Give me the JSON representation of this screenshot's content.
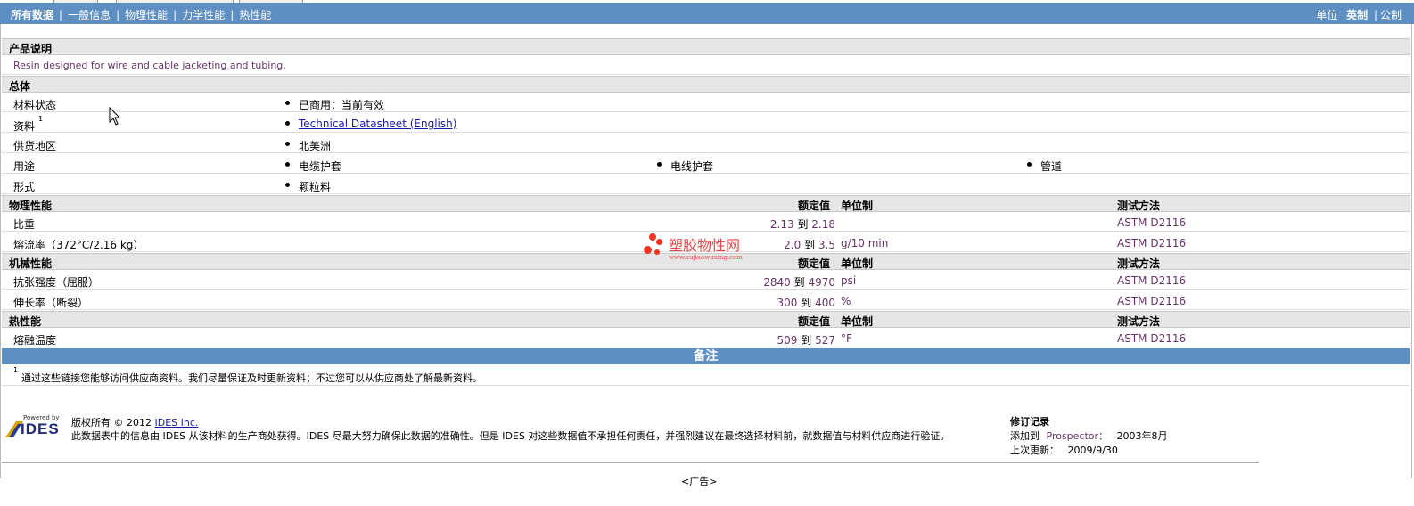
{
  "nav": {
    "tabs": [
      "所有数据",
      "一般信息",
      "物理性能",
      "力学性能",
      "热性能"
    ],
    "unit_label": "单位",
    "unit_english": "英制",
    "unit_metric": "公制"
  },
  "description": {
    "header": "产品说明",
    "text": "Resin designed for wire and cable jacketing and tubing."
  },
  "general": {
    "header": "总体",
    "rows": [
      {
        "label": "材料状态",
        "values": [
          "已商用：当前有效"
        ]
      },
      {
        "label": "资料",
        "sup": "1",
        "values": [
          "Technical Datasheet (English)"
        ]
      },
      {
        "label": "供货地区",
        "values": [
          "北美洲"
        ]
      },
      {
        "label": "用途",
        "values": [
          "电缆护套",
          "电线护套",
          "管道"
        ]
      },
      {
        "label": "形式",
        "values": [
          "颗粒料"
        ]
      }
    ]
  },
  "physical": {
    "header": "物理性能",
    "col_value": "额定值",
    "col_unit": "单位制",
    "col_test": "测试方法",
    "rows": [
      {
        "label": "比重",
        "low": "2.13",
        "to": "到",
        "high": "2.18",
        "unit": "",
        "test": "ASTM D2116"
      },
      {
        "label": "熔流率（372°C/2.16 kg）",
        "low": "2.0",
        "to": "到",
        "high": "3.5",
        "unit": "g/10 min",
        "test": "ASTM D2116"
      }
    ]
  },
  "mechanical": {
    "header": "机械性能",
    "col_value": "额定值",
    "col_unit": "单位制",
    "col_test": "测试方法",
    "rows": [
      {
        "label": "抗张强度（屈服）",
        "low": "2840",
        "to": "到",
        "high": "4970",
        "unit": "psi",
        "test": "ASTM D2116"
      },
      {
        "label": "伸长率（断裂）",
        "low": "300",
        "to": "到",
        "high": "400",
        "unit": "%",
        "test": "ASTM D2116"
      }
    ]
  },
  "thermal": {
    "header": "热性能",
    "col_value": "额定值",
    "col_unit": "单位制",
    "col_test": "测试方法",
    "rows": [
      {
        "label": "熔融温度",
        "low": "509",
        "to": "到",
        "high": "527",
        "unit": "°F",
        "test": "ASTM D2116"
      }
    ]
  },
  "notes": {
    "header": "备注",
    "sup": "1",
    "text": "通过这些链接您能够访问供应商资料。我们尽量保证及时更新资料；不过您可以从供应商处了解最新资料。"
  },
  "watermark": {
    "name": "塑胶物性网",
    "url": "www.sujiaowuxing.com"
  },
  "footer": {
    "logo_small": "Powered by",
    "logo": "IDES",
    "copyright": "版权所有 © 2012",
    "company_link": "IDES Inc.",
    "disclaimer": "此数据表中的信息由 IDES 从该材料的生产商处获得。IDES 尽最大努力确保此数据的准确性。但是 IDES 对这些数据值不承担任何责任，并强烈建议在最终选择材料前，就数据值与材料供应商进行验证。",
    "revision_title": "修订记录",
    "added_label": "添加到",
    "added_target": "Prospector：",
    "added_date": "2003年8月",
    "updated_label": "上次更新：",
    "updated_date": "2009/9/30",
    "ad": "<广告>"
  }
}
